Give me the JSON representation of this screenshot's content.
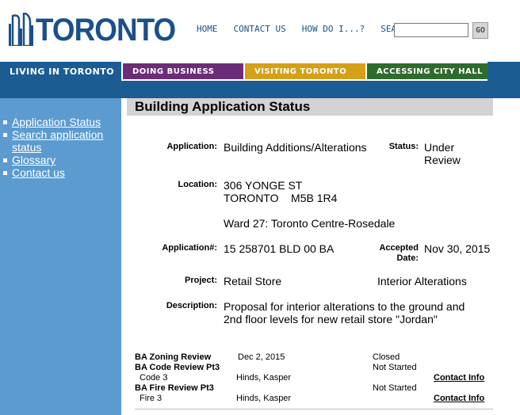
{
  "header": {
    "logo_text": "TORONTO",
    "nav": [
      "HOME",
      "CONTACT US",
      "HOW DO I...?"
    ],
    "search_label": "SEARCH:",
    "search_value": "",
    "go_label": "GO"
  },
  "mainnav": {
    "living": "LIVING IN TORONTO",
    "doing": "DOING BUSINESS",
    "visiting": "VISITING TORONTO",
    "accessing": "ACCESSING CITY HALL"
  },
  "sidebar": {
    "items": [
      "Application Status",
      "Search application status",
      "Glossary",
      "Contact us"
    ]
  },
  "page": {
    "title": "Building Application Status",
    "application_label": "Application:",
    "application_value": "Building Additions/Alterations",
    "status_label": "Status:",
    "status_value": "Under Review",
    "location_label": "Location:",
    "location_line1": "306 YONGE ST",
    "location_line2": "TORONTO    M5B 1R4",
    "ward": "Ward 27: Toronto Centre-Rosedale",
    "appno_label": "Application#:",
    "appno_value": "15 258701 BLD 00 BA",
    "accepted_label": "Accepted Date:",
    "accepted_value": "Nov 30, 2015",
    "project_label": "Project:",
    "project_value": "Retail Store",
    "project_type": "Interior Alterations",
    "description_label": "Description:",
    "description_value": "Proposal for interior alterations to the ground and 2nd floor levels for new retail store \"Jordan\""
  },
  "reviews": [
    {
      "name": "BA Zoning Review",
      "date": "Dec 2, 2015",
      "status": "Closed"
    },
    {
      "name": "BA Code Review Pt3",
      "sub": "Code 3",
      "person": "Hinds, Kasper",
      "status": "Not Started",
      "contact": "Contact Info"
    },
    {
      "name": "BA Fire Review Pt3",
      "sub": "Fire 3",
      "person": "Hinds, Kasper",
      "status": "Not Started",
      "contact": "Contact Info"
    }
  ]
}
